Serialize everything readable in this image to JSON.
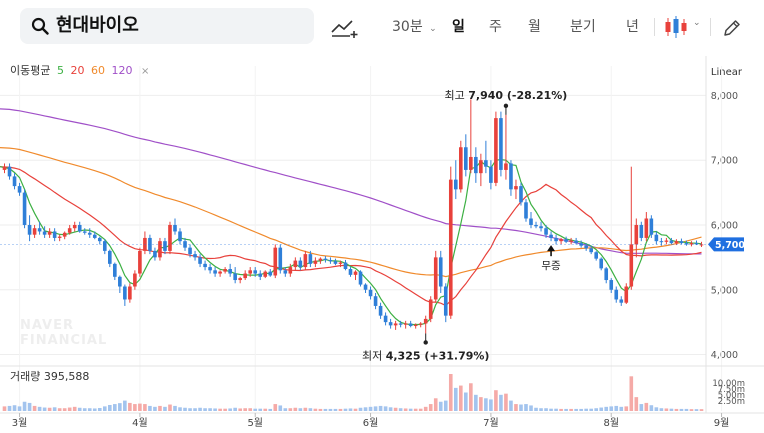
{
  "search": {
    "query": "현대바이오"
  },
  "toolbar": {
    "interval_label": "30분",
    "periods": [
      "일",
      "주",
      "월",
      "분기",
      "년"
    ],
    "active_period": "일",
    "icons": [
      "draw-line-icon",
      "candle-type-icon",
      "pencil-icon"
    ]
  },
  "ma_legend": {
    "title": "이동평균",
    "items": [
      {
        "label": "5",
        "color": "#3cb043"
      },
      {
        "label": "20",
        "color": "#e8413b"
      },
      {
        "label": "60",
        "color": "#f08a2c"
      },
      {
        "label": "120",
        "color": "#a050c8"
      }
    ],
    "close": "×"
  },
  "scale": {
    "label": "Linear"
  },
  "annotations": {
    "high": {
      "label": "최고",
      "value": "7,940",
      "change": "(-28.21%)"
    },
    "low": {
      "label": "최저",
      "value": "4,325",
      "change": "(+31.79%)"
    },
    "event": {
      "label": "무증"
    }
  },
  "watermark": {
    "line1": "NAVER",
    "line2": "FINANCIAL"
  },
  "volume": {
    "label": "거래량",
    "value": "395,588",
    "ticks": [
      "10.00m",
      "7.50m",
      "5.00m",
      "2.50m"
    ]
  },
  "colors": {
    "up": "#e8413b",
    "down": "#2f7fd8",
    "price_tag": "#1f6fe0",
    "grid": "#eeeeee"
  },
  "chart_data": {
    "type": "candlestick",
    "y_axis": {
      "ticks": [
        4000,
        5000,
        6000,
        7000,
        8000
      ],
      "tick_labels": [
        "4,000",
        "5,000",
        "6,000",
        "7,000",
        "8,000"
      ],
      "range": [
        3900,
        8300
      ]
    },
    "x_axis": {
      "labels": [
        "3월",
        "4월",
        "5월",
        "6월",
        "7월",
        "8월",
        "9월"
      ],
      "label_index": [
        3,
        27,
        50,
        73,
        97,
        121,
        143
      ]
    },
    "current_price": 5700,
    "current_price_label": "5,700",
    "high_index": 100,
    "low_index": 84,
    "event_index": 109,
    "candles": [
      [
        6850,
        6950,
        6800,
        6900,
        20
      ],
      [
        6900,
        6950,
        6700,
        6750,
        22
      ],
      [
        6750,
        6800,
        6550,
        6600,
        25
      ],
      [
        6600,
        6650,
        6450,
        6500,
        20
      ],
      [
        6500,
        6550,
        5950,
        6000,
        40
      ],
      [
        6000,
        6150,
        5750,
        5850,
        35
      ],
      [
        5850,
        6000,
        5800,
        5950,
        22
      ],
      [
        5950,
        6050,
        5850,
        5900,
        18
      ],
      [
        5900,
        5980,
        5800,
        5850,
        15
      ],
      [
        5850,
        5950,
        5800,
        5900,
        14
      ],
      [
        5900,
        5950,
        5750,
        5800,
        16
      ],
      [
        5800,
        5850,
        5750,
        5820,
        12
      ],
      [
        5820,
        5900,
        5780,
        5880,
        12
      ],
      [
        5880,
        6000,
        5850,
        5950,
        15
      ],
      [
        5950,
        6050,
        5900,
        6000,
        18
      ],
      [
        6000,
        6050,
        5880,
        5900,
        14
      ],
      [
        5900,
        5950,
        5850,
        5880,
        12
      ],
      [
        5880,
        5950,
        5800,
        5850,
        12
      ],
      [
        5850,
        5900,
        5780,
        5800,
        11
      ],
      [
        5800,
        5820,
        5700,
        5750,
        13
      ],
      [
        5750,
        5780,
        5550,
        5600,
        20
      ],
      [
        5600,
        5620,
        5350,
        5400,
        26
      ],
      [
        5400,
        5420,
        5150,
        5200,
        30
      ],
      [
        5200,
        5220,
        4950,
        5050,
        34
      ],
      [
        5050,
        5080,
        4750,
        4850,
        45
      ],
      [
        4850,
        5100,
        4800,
        5050,
        35
      ],
      [
        5050,
        5300,
        5000,
        5250,
        30
      ],
      [
        5250,
        5650,
        5200,
        5600,
        32
      ],
      [
        5600,
        5900,
        5550,
        5800,
        30
      ],
      [
        5800,
        5850,
        5550,
        5600,
        22
      ],
      [
        5600,
        5650,
        5450,
        5500,
        18
      ],
      [
        5500,
        5800,
        5450,
        5750,
        22
      ],
      [
        5750,
        5800,
        5550,
        5600,
        18
      ],
      [
        5600,
        6050,
        5550,
        6000,
        28
      ],
      [
        6000,
        6100,
        5850,
        5900,
        22
      ],
      [
        5900,
        5950,
        5700,
        5750,
        16
      ],
      [
        5750,
        5800,
        5600,
        5650,
        14
      ],
      [
        5650,
        5700,
        5500,
        5550,
        12
      ],
      [
        5550,
        5600,
        5450,
        5500,
        12
      ],
      [
        5500,
        5550,
        5350,
        5400,
        14
      ],
      [
        5400,
        5450,
        5300,
        5350,
        12
      ],
      [
        5350,
        5400,
        5250,
        5300,
        12
      ],
      [
        5300,
        5350,
        5200,
        5250,
        11
      ],
      [
        5250,
        5300,
        5200,
        5280,
        10
      ],
      [
        5280,
        5350,
        5250,
        5320,
        10
      ],
      [
        5320,
        5400,
        5200,
        5250,
        11
      ],
      [
        5250,
        5350,
        5100,
        5150,
        14
      ],
      [
        5150,
        5200,
        5100,
        5180,
        11
      ],
      [
        5180,
        5300,
        5150,
        5250,
        12
      ],
      [
        5250,
        5350,
        5200,
        5300,
        12
      ],
      [
        5300,
        5350,
        5200,
        5250,
        10
      ],
      [
        5250,
        5300,
        5150,
        5200,
        10
      ],
      [
        5200,
        5300,
        5180,
        5280,
        10
      ],
      [
        5280,
        5320,
        5200,
        5220,
        9
      ],
      [
        5220,
        5700,
        5180,
        5650,
        30
      ],
      [
        5650,
        5700,
        5250,
        5300,
        24
      ],
      [
        5300,
        5350,
        5200,
        5250,
        12
      ],
      [
        5250,
        5400,
        5200,
        5350,
        12
      ],
      [
        5350,
        5500,
        5300,
        5450,
        14
      ],
      [
        5450,
        5500,
        5300,
        5350,
        12
      ],
      [
        5350,
        5600,
        5300,
        5550,
        14
      ],
      [
        5550,
        5600,
        5350,
        5400,
        12
      ],
      [
        5400,
        5500,
        5350,
        5450,
        10
      ],
      [
        5450,
        5500,
        5400,
        5480,
        9
      ],
      [
        5480,
        5520,
        5420,
        5460,
        9
      ],
      [
        5460,
        5500,
        5400,
        5440,
        9
      ],
      [
        5440,
        5480,
        5380,
        5400,
        9
      ],
      [
        5400,
        5450,
        5350,
        5420,
        9
      ],
      [
        5420,
        5460,
        5300,
        5320,
        10
      ],
      [
        5320,
        5350,
        5200,
        5230,
        11
      ],
      [
        5230,
        5300,
        5150,
        5280,
        10
      ],
      [
        5280,
        5300,
        5050,
        5080,
        14
      ],
      [
        5080,
        5100,
        4950,
        5000,
        16
      ],
      [
        5000,
        5050,
        4850,
        4900,
        18
      ],
      [
        4900,
        4950,
        4700,
        4750,
        20
      ],
      [
        4750,
        4800,
        4550,
        4600,
        22
      ],
      [
        4600,
        4650,
        4450,
        4500,
        20
      ],
      [
        4500,
        4550,
        4400,
        4450,
        16
      ],
      [
        4450,
        4520,
        4380,
        4480,
        14
      ],
      [
        4480,
        4520,
        4420,
        4460,
        12
      ],
      [
        4460,
        4520,
        4400,
        4480,
        11
      ],
      [
        4480,
        4520,
        4420,
        4440,
        10
      ],
      [
        4440,
        4480,
        4400,
        4460,
        10
      ],
      [
        4460,
        4500,
        4420,
        4480,
        10
      ],
      [
        4480,
        4600,
        4325,
        4550,
        18
      ],
      [
        4550,
        4900,
        4500,
        4850,
        30
      ],
      [
        4850,
        5600,
        4800,
        5500,
        55
      ],
      [
        5500,
        5600,
        4950,
        5050,
        40
      ],
      [
        5050,
        5100,
        4500,
        4600,
        45
      ],
      [
        4600,
        6900,
        4550,
        6700,
        160
      ],
      [
        6700,
        7000,
        6400,
        6550,
        100
      ],
      [
        6550,
        7300,
        6500,
        7200,
        110
      ],
      [
        7200,
        7400,
        6750,
        6850,
        80
      ],
      [
        6850,
        7940,
        6800,
        7050,
        120
      ],
      [
        7050,
        7200,
        6650,
        6800,
        70
      ],
      [
        6800,
        7100,
        6600,
        7000,
        60
      ],
      [
        7000,
        7300,
        6800,
        6900,
        55
      ],
      [
        6900,
        7000,
        6550,
        6650,
        50
      ],
      [
        6650,
        7750,
        6600,
        7650,
        90
      ],
      [
        7650,
        7750,
        6750,
        6850,
        70
      ],
      [
        6850,
        7700,
        6700,
        6950,
        75
      ],
      [
        6950,
        7000,
        6450,
        6550,
        45
      ],
      [
        6550,
        6700,
        6400,
        6600,
        30
      ],
      [
        6600,
        6650,
        6300,
        6350,
        28
      ],
      [
        6350,
        6400,
        6050,
        6100,
        30
      ],
      [
        6100,
        6200,
        5950,
        6000,
        24
      ],
      [
        6000,
        6050,
        5950,
        5980,
        14
      ],
      [
        5980,
        6050,
        5900,
        5950,
        12
      ],
      [
        5950,
        6000,
        5800,
        5850,
        12
      ],
      [
        5850,
        5900,
        5750,
        5800,
        10
      ],
      [
        5800,
        5850,
        5700,
        5750,
        10
      ],
      [
        5750,
        5800,
        5700,
        5780,
        9
      ],
      [
        5780,
        5820,
        5720,
        5740,
        9
      ],
      [
        5740,
        5800,
        5700,
        5760,
        9
      ],
      [
        5760,
        5800,
        5700,
        5720,
        9
      ],
      [
        5720,
        5760,
        5650,
        5680,
        9
      ],
      [
        5680,
        5720,
        5600,
        5640,
        10
      ],
      [
        5640,
        5680,
        5550,
        5580,
        10
      ],
      [
        5580,
        5600,
        5450,
        5480,
        12
      ],
      [
        5480,
        5500,
        5300,
        5330,
        15
      ],
      [
        5330,
        5350,
        5100,
        5150,
        18
      ],
      [
        5150,
        5180,
        4950,
        5000,
        20
      ],
      [
        5000,
        5050,
        4800,
        4850,
        22
      ],
      [
        4850,
        4900,
        4750,
        4800,
        18
      ],
      [
        4800,
        5100,
        4780,
        5050,
        20
      ],
      [
        5050,
        6900,
        5000,
        5700,
        150
      ],
      [
        5700,
        6100,
        5500,
        6000,
        60
      ],
      [
        6000,
        6050,
        5750,
        5800,
        30
      ],
      [
        5800,
        6200,
        5750,
        6100,
        35
      ],
      [
        6100,
        6150,
        5800,
        5850,
        25
      ],
      [
        5850,
        5900,
        5700,
        5750,
        16
      ],
      [
        5750,
        5800,
        5680,
        5740,
        12
      ],
      [
        5740,
        5800,
        5700,
        5760,
        11
      ],
      [
        5760,
        5800,
        5700,
        5720,
        10
      ],
      [
        5720,
        5780,
        5690,
        5750,
        9
      ],
      [
        5750,
        5790,
        5700,
        5720,
        9
      ],
      [
        5720,
        5760,
        5680,
        5700,
        9
      ],
      [
        5700,
        5750,
        5670,
        5720,
        8
      ],
      [
        5720,
        5760,
        5690,
        5700,
        8
      ],
      [
        5700,
        5740,
        5660,
        5700,
        8
      ]
    ]
  }
}
